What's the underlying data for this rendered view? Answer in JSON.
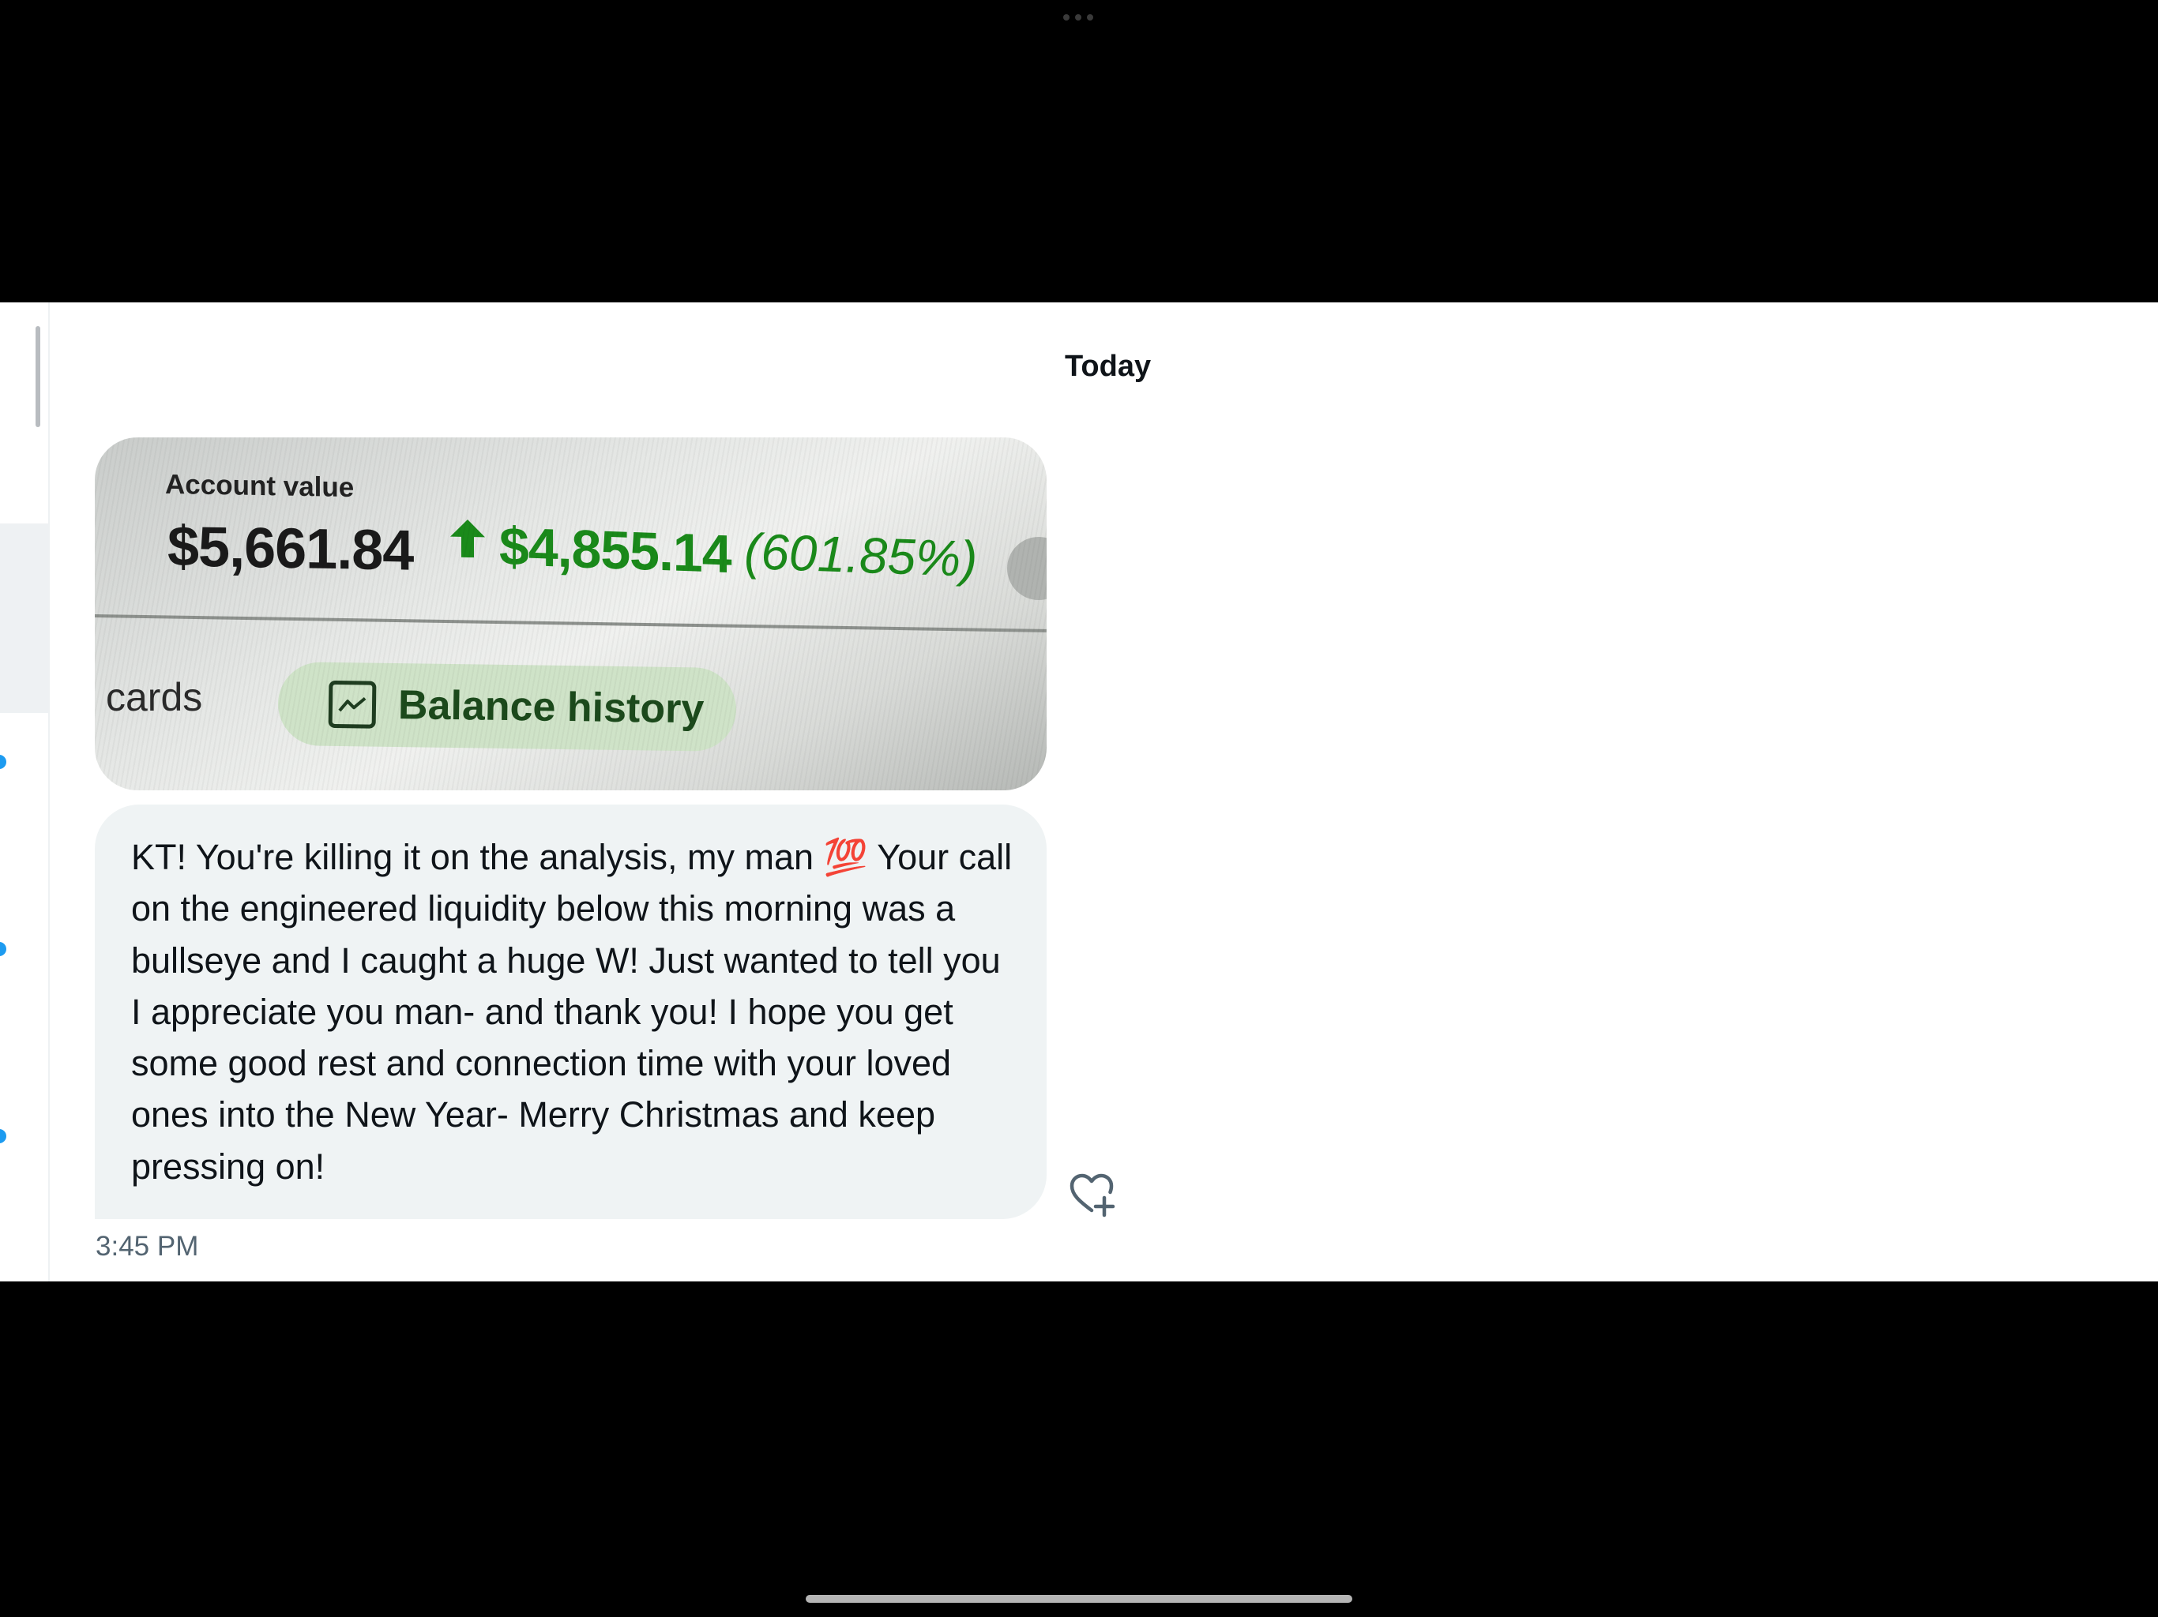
{
  "conversation": {
    "date_separator": "Today",
    "attachment": {
      "label": "Account value",
      "value": "$5,661.84",
      "change": "$4,855.14",
      "change_percent": "(601.85%)",
      "partial_tab": "cards",
      "button_label": "Balance history",
      "accent_color": "#1a8a1a"
    },
    "message": {
      "text": "KT! You're killing it on the analysis, my man 💯 Your call on the engineered liquidity below this morning was a bullseye and I caught a huge W! Just wanted to tell you I appreciate you man- and thank you! I hope you get some good rest and connection time with your loved ones into the New Year- Merry Christmas and keep pressing on!",
      "time": "3:45 PM"
    },
    "react_icon": "heart-plus-icon"
  },
  "colors": {
    "bubble_bg": "#eff3f4",
    "text": "#0f1419",
    "muted": "#536471",
    "unread_dot": "#1d9bf0"
  }
}
